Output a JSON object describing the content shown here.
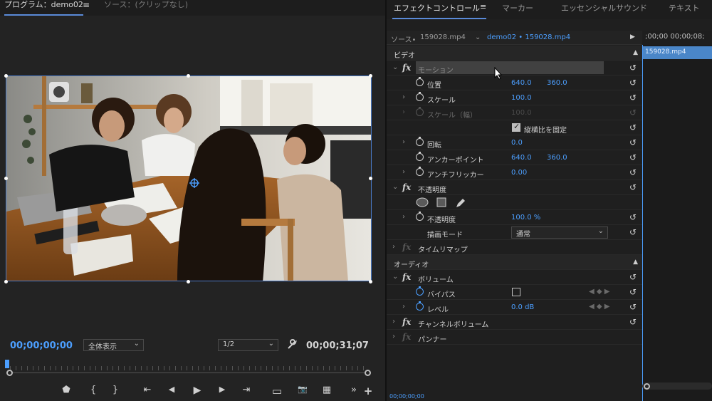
{
  "program": {
    "tab_active": "プログラム：demo02",
    "tab_menu": "≡",
    "tab_inactive": "ソース：(クリップなし)",
    "timecode_current": "00;00;00;00",
    "zoom_select": "全体表示",
    "resolution_select": "1/2",
    "timecode_duration": "00;00;31;07",
    "transport": {
      "marker": "⬟",
      "in": "{",
      "out": "}",
      "goto_in": "⇤",
      "step_back": "◀",
      "play": "▶",
      "step_forward": "▶",
      "goto_out": "⇥",
      "safe_margins": "▭",
      "export_frame": "📷",
      "compare": "▦",
      "more": "»",
      "add": "+"
    }
  },
  "effects": {
    "tabs": [
      "エフェクトコントロール",
      "マーカー",
      "エッセンシャルサウンド",
      "テキスト"
    ],
    "tab_menu": "≡",
    "source_label": "ソース•",
    "source_clip": "159028.mp4",
    "sequence_clip": "demo02 • 159028.mp4",
    "play_arrow": "▶",
    "timeline_ruler": ";00;00   00;00;08;",
    "timeline_clip": "159028.mp4",
    "bottom_timecode": "00;00;00;00",
    "video_section": "ビデオ",
    "audio_section": "オーディオ",
    "fx_symbol": "fx",
    "reset_symbol": "↺",
    "motion": {
      "name": "モーション",
      "position_label": "位置",
      "position_x": "640.0",
      "position_y": "360.0",
      "scale_label": "スケール",
      "scale_value": "100.0",
      "scale_width_label": "スケール（幅）",
      "scale_width_value": "100.0",
      "uniform_scale_label": "縦横比を固定",
      "rotation_label": "回転",
      "rotation_value": "0.0",
      "anchor_label": "アンカーポイント",
      "anchor_x": "640.0",
      "anchor_y": "360.0",
      "flicker_label": "アンチフリッカー",
      "flicker_value": "0.00"
    },
    "opacity": {
      "name": "不透明度",
      "opacity_label": "不透明度",
      "opacity_value": "100.0 %",
      "blend_label": "描画モード",
      "blend_value": "通常"
    },
    "time_remap": "タイムリマップ",
    "volume": {
      "name": "ボリューム",
      "bypass_label": "バイパス",
      "level_label": "レベル",
      "level_value": "0.0 dB"
    },
    "channel_volume": "チャンネルボリューム",
    "panner": "パンナー",
    "keyframe_nav": "◀ ◆ ▶"
  },
  "colors": {
    "accent_blue": "#4c9fff",
    "clip_blue": "#4a86c8",
    "panel_bg": "#1f1f1f"
  }
}
